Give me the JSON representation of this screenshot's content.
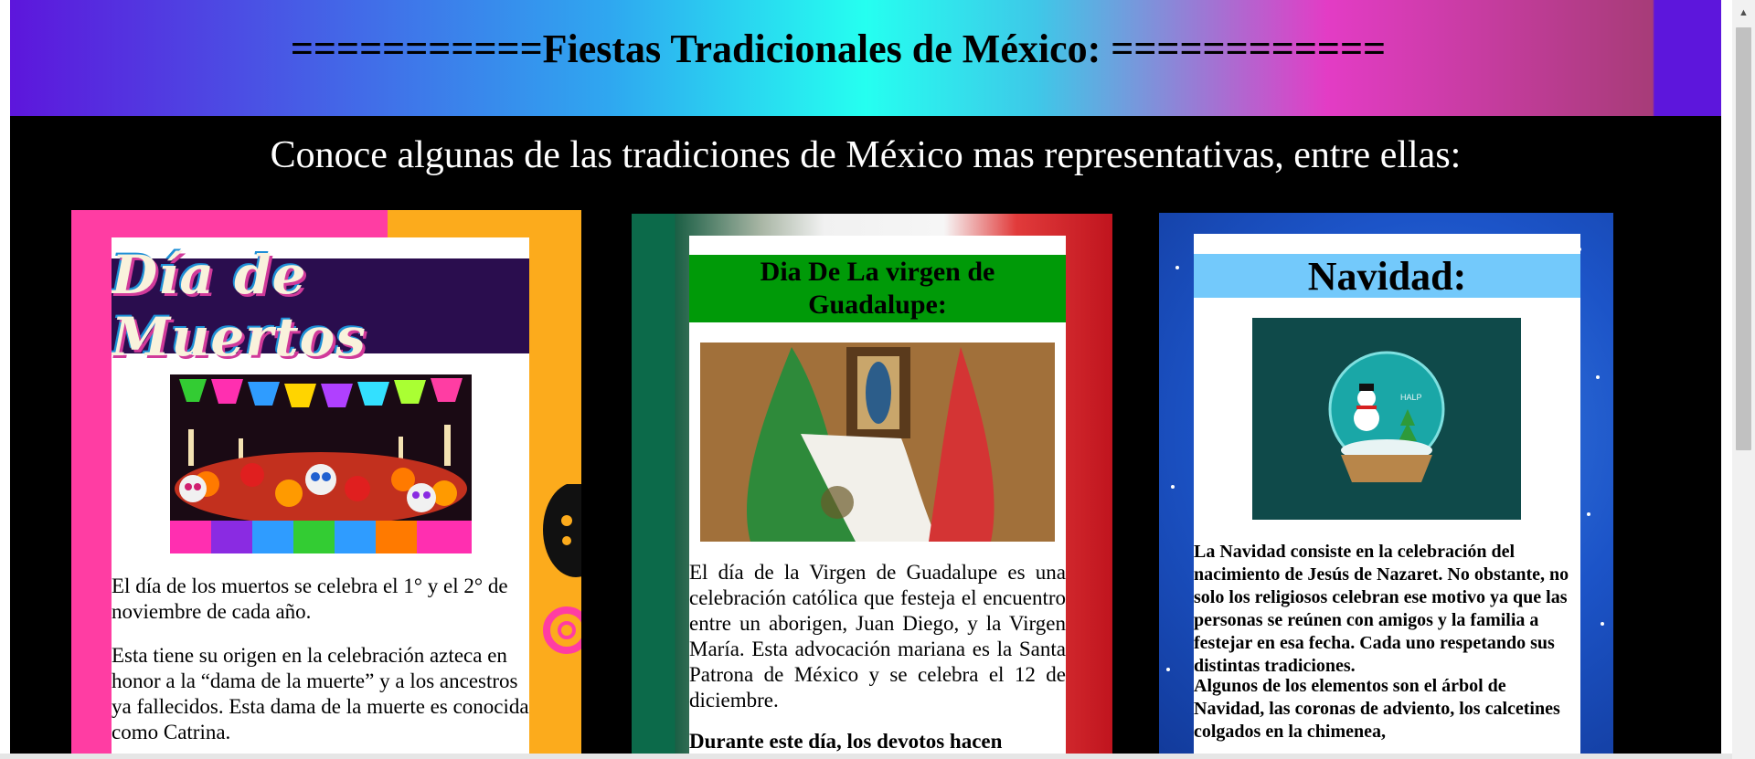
{
  "header": {
    "title": "===========Fiestas Tradicionales de México: ============"
  },
  "subtitle": "Conoce algunas de las tradiciones de México mas representativas, entre ellas:",
  "cards": [
    {
      "logo_text": "Día de Muertos",
      "paragraphs": [
        "El día de los muertos se celebra el 1° y el 2° de noviembre de cada año.",
        "Esta tiene su origen en la celebración azteca en honor a la “dama de la muerte” y a los ancestros ya fallecidos. Esta dama de la muerte es conocida como Catrina."
      ]
    },
    {
      "title": "Dia De La virgen de Guadalupe:",
      "paragraphs": [
        "El día de la Virgen de Guadalupe es una celebración católica que festeja el encuentro entre un aborigen, Juan Diego, y la Virgen María. Esta advocación mariana es la Santa Patrona de México y se celebra el 12 de diciembre.",
        "Durante este día, los devotos hacen"
      ]
    },
    {
      "title": "Navidad:",
      "image_caption": "HALP",
      "paragraphs": [
        "La Navidad consiste en la celebración del nacimiento de Jesús de Nazaret. No obstante, no solo los religiosos celebran ese motivo ya que las personas se reúnen con amigos y la familia a festejar en esa fecha. Cada uno respetando sus distintas tradiciones.",
        "Algunos de los elementos son el árbol de Navidad, las coronas de adviento, los calcetines colgados en la chimenea,"
      ]
    }
  ],
  "colors": {
    "page_background": "#000000",
    "card_background": "#ffffff",
    "guadalupe_header": "#009a08",
    "navidad_header": "#73c9fb",
    "muertos_logo_background": "#2a0d4e"
  },
  "icons": {
    "scroll_up": "▲"
  }
}
